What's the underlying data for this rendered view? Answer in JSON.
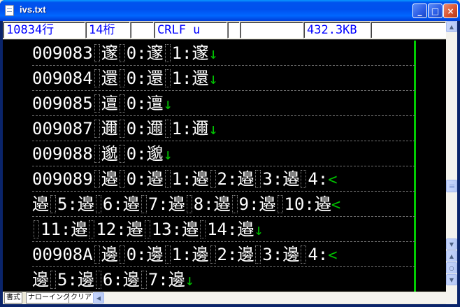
{
  "window": {
    "title": "ivs.txt"
  },
  "titlebar_buttons": {
    "minimize": "_",
    "maximize": "□",
    "close": "×"
  },
  "status": {
    "lines": "10834行",
    "column": "14桁",
    "blank1": "",
    "newline": "CRLF u",
    "blank2": "",
    "blank3": "",
    "size": "432.3KB",
    "blank4": ""
  },
  "editor": {
    "rows": [
      {
        "parts": [
          "009083",
          "邃",
          "0:邃",
          "1:邃"
        ],
        "end": "↓"
      },
      {
        "parts": [
          "009084",
          "還",
          "0:還",
          "1:還"
        ],
        "end": "↓"
      },
      {
        "parts": [
          "009085",
          "邅",
          "0:邅"
        ],
        "end": "↓"
      },
      {
        "parts": [
          "009087",
          "邇",
          "0:邇",
          "1:邇"
        ],
        "end": "↓"
      },
      {
        "parts": [
          "009088",
          "邈",
          "0:邈"
        ],
        "end": "↓"
      },
      {
        "parts": [
          "009089",
          "邉",
          "0:邉",
          "1:邉",
          "2:邉",
          "3:邉",
          "4:"
        ],
        "end": "<"
      },
      {
        "parts": [
          "邉",
          "5:邉",
          "6:邉",
          "7:邉",
          "8:邉",
          "9:邉",
          "10:邉"
        ],
        "end": "<"
      },
      {
        "parts": [
          "",
          "11:邉",
          "12:邉",
          "13:邉",
          "14:邉"
        ],
        "end": "↓"
      },
      {
        "parts": [
          "00908A",
          "邊",
          "0:邊",
          "1:邊",
          "2:邊",
          "3:邊",
          "4:"
        ],
        "end": "<"
      },
      {
        "parts": [
          "邊",
          "5:邊",
          "6:邊",
          "7:邊"
        ],
        "end": "↓"
      }
    ]
  },
  "tabs": {
    "format": "書式",
    "narrowing": "ナローイング",
    "clear": "クリア"
  },
  "colors": {
    "text": "#ffffff",
    "newline_mark": "#00c000",
    "status_text": "#0000ff",
    "cursor_bar": "#00cc00",
    "background": "#000000"
  }
}
